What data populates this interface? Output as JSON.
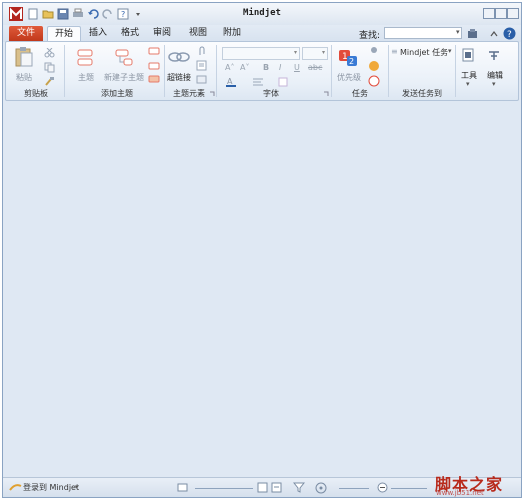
{
  "window": {
    "title": "Mindjet"
  },
  "tabs": {
    "file": "文件",
    "items": [
      "开始",
      "插入",
      "格式",
      "审阅",
      "视图",
      "附加"
    ]
  },
  "find": {
    "label": "查找:",
    "value": ""
  },
  "ribbon": {
    "clipboard": {
      "paste": "粘贴",
      "label": "剪贴板"
    },
    "add_topic": {
      "topic": "主题",
      "subtopic": "新建子主题",
      "label": "添加主题"
    },
    "topic_elements": {
      "hyperlink": "超链接",
      "label": "主题元素"
    },
    "font": {
      "label": "字体",
      "bold": "B",
      "italic": "I",
      "underline": "U"
    },
    "tasks": {
      "priority": "优先级",
      "label": "任务"
    },
    "send_tasks": {
      "mindjet_tasks": "Mindjet 任务",
      "label": "发送任务到"
    },
    "tools": {
      "label": "工具"
    },
    "edit": {
      "label": "编辑"
    }
  },
  "statusbar": {
    "login": "登录到 Mindjet"
  },
  "watermark": {
    "text": "脚本之家",
    "url": "www.jb51.net"
  },
  "colors": {
    "file_tab": "#c0381b",
    "accent": "#2a5fa8",
    "canvas": "#dfe8f3"
  }
}
